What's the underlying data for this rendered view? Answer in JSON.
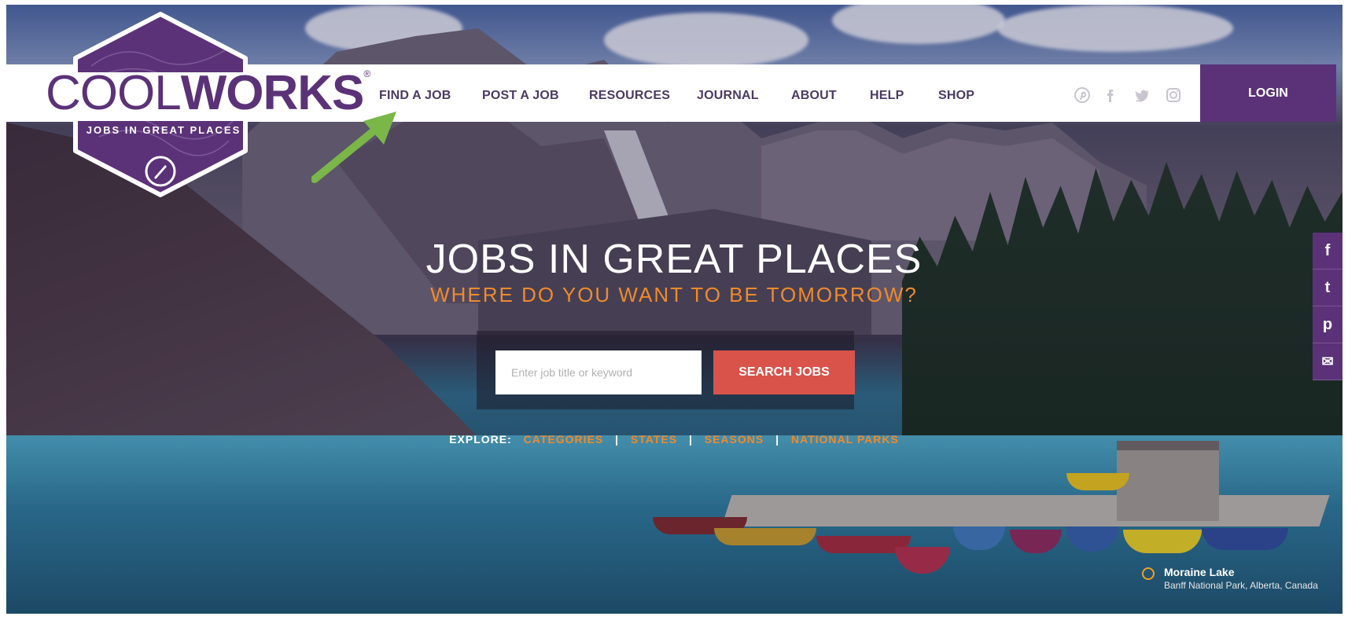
{
  "brand": {
    "name_light": "COOL",
    "name_bold": "WORKS",
    "registered": "®",
    "tagline": "JOBS IN GREAT PLACES",
    "color": "#5b3278"
  },
  "nav": {
    "items": [
      {
        "label": "FIND A JOB"
      },
      {
        "label": "POST A JOB"
      },
      {
        "label": "RESOURCES"
      },
      {
        "label": "JOURNAL"
      },
      {
        "label": "ABOUT"
      },
      {
        "label": "HELP"
      },
      {
        "label": "SHOP"
      }
    ],
    "social_icons": [
      "pinterest-icon",
      "facebook-icon",
      "twitter-icon",
      "instagram-icon"
    ],
    "login_label": "LOGIN"
  },
  "hero": {
    "title": "JOBS IN GREAT PLACES",
    "subtitle": "WHERE DO YOU WANT TO BE TOMORROW?",
    "accent_color": "#f08a2a"
  },
  "search": {
    "placeholder": "Enter job title or keyword",
    "value": "",
    "button_label": "SEARCH JOBS",
    "button_color": "#d9534a"
  },
  "explore": {
    "label": "EXPLORE:",
    "links": [
      "CATEGORIES",
      "STATES",
      "SEASONS",
      "NATIONAL PARKS"
    ],
    "separator": "|"
  },
  "share_rail": {
    "icons": [
      "facebook-icon",
      "twitter-icon",
      "pinterest-icon",
      "mail-icon"
    ],
    "glyphs": [
      "f",
      "t",
      "p",
      "✉"
    ]
  },
  "photo_caption": {
    "name": "Moraine Lake",
    "place": "Banff National Park, Alberta, Canada"
  },
  "annotation": {
    "arrow_color": "#7ab648"
  }
}
